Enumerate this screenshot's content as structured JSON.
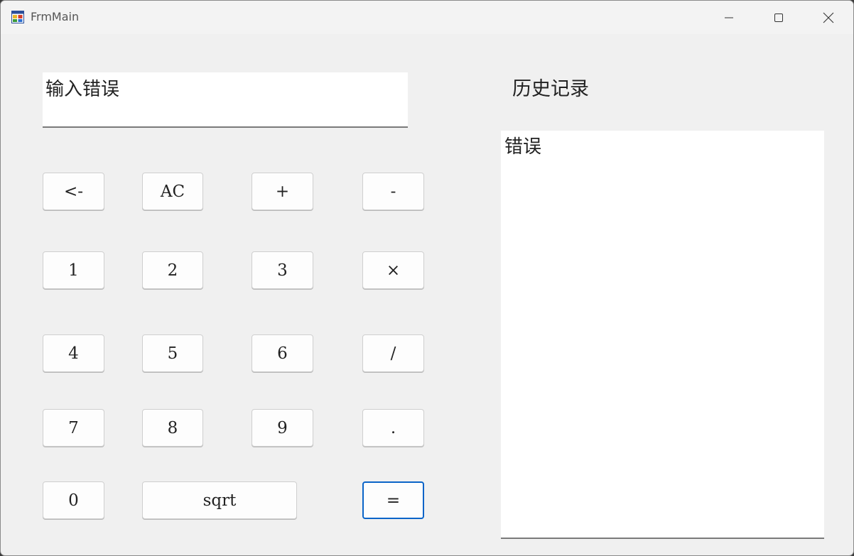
{
  "window": {
    "title": "FrmMain"
  },
  "display": {
    "value": "输入错误"
  },
  "history": {
    "label": "历史记录",
    "content": "错误"
  },
  "buttons": {
    "backspace": "<-",
    "ac": "AC",
    "plus": "+",
    "minus": "-",
    "one": "1",
    "two": "2",
    "three": "3",
    "multiply": "×",
    "four": "4",
    "five": "5",
    "six": "6",
    "divide": "/",
    "seven": "7",
    "eight": "8",
    "nine": "9",
    "dot": ".",
    "zero": "0",
    "sqrt": "sqrt",
    "equals": "="
  },
  "colors": {
    "accent": "#0a64c8",
    "window_bg": "#f0f0f0"
  },
  "icons": {
    "app": "app-window-icon",
    "min": "minimize-icon",
    "max": "maximize-icon",
    "close": "close-icon"
  }
}
